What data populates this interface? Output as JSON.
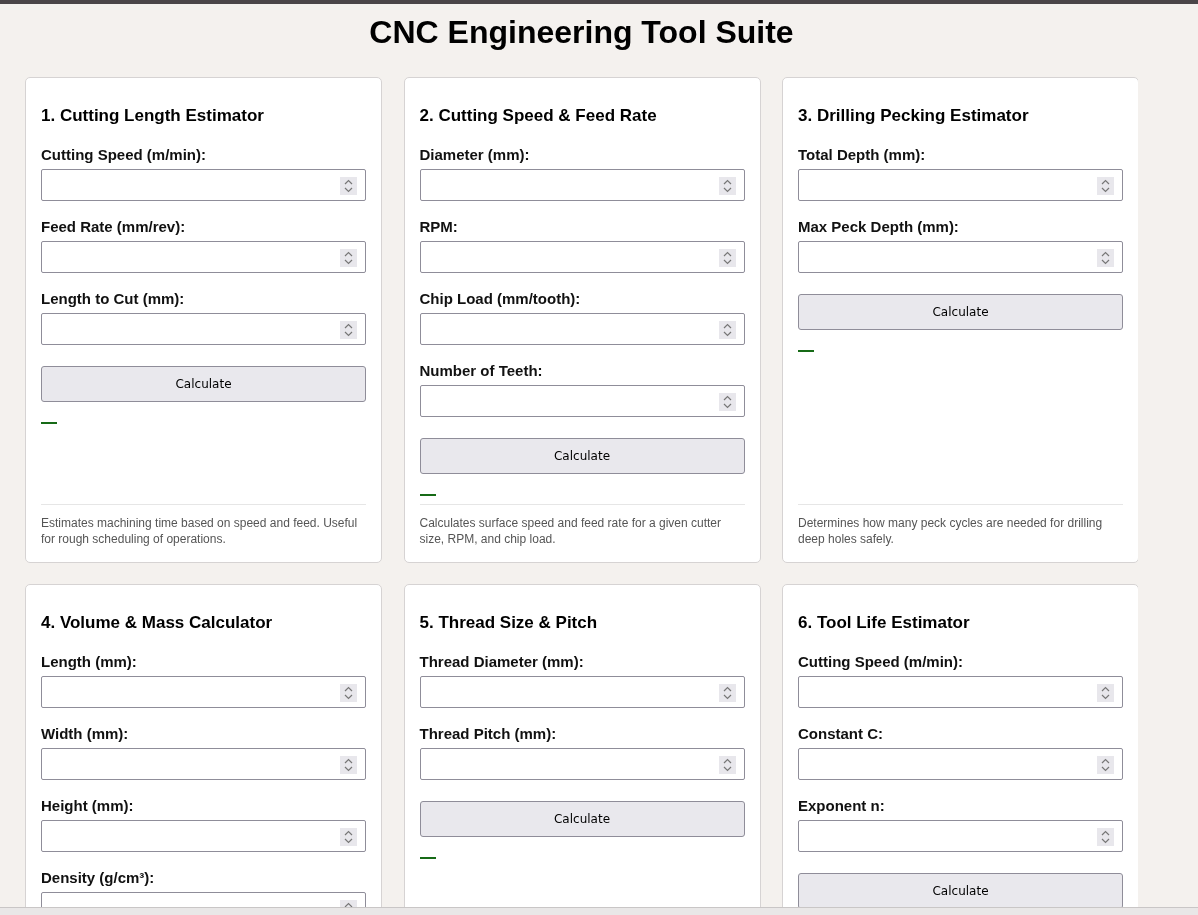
{
  "title": "CNC Engineering Tool Suite",
  "tools": [
    {
      "title": "1. Cutting Length Estimator",
      "fields": [
        {
          "label": "Cutting Speed (m/min):"
        },
        {
          "label": "Feed Rate (mm/rev):"
        },
        {
          "label": "Length to Cut (mm):"
        }
      ],
      "button": "Calculate",
      "description": "Estimates machining time based on speed and feed. Useful for rough scheduling of operations."
    },
    {
      "title": "2. Cutting Speed & Feed Rate",
      "fields": [
        {
          "label": "Diameter (mm):"
        },
        {
          "label": "RPM:"
        },
        {
          "label": "Chip Load (mm/tooth):"
        },
        {
          "label": "Number of Teeth:"
        }
      ],
      "button": "Calculate",
      "description": "Calculates surface speed and feed rate for a given cutter size, RPM, and chip load."
    },
    {
      "title": "3. Drilling Pecking Estimator",
      "fields": [
        {
          "label": "Total Depth (mm):"
        },
        {
          "label": "Max Peck Depth (mm):"
        }
      ],
      "button": "Calculate",
      "description": "Determines how many peck cycles are needed for drilling deep holes safely."
    },
    {
      "title": "4. Volume & Mass Calculator",
      "fields": [
        {
          "label": "Length (mm):"
        },
        {
          "label": "Width (mm):"
        },
        {
          "label": "Height (mm):"
        },
        {
          "label": "Density (g/cm³):"
        }
      ]
    },
    {
      "title": "5. Thread Size & Pitch",
      "fields": [
        {
          "label": "Thread Diameter (mm):"
        },
        {
          "label": "Thread Pitch (mm):"
        }
      ],
      "button": "Calculate"
    },
    {
      "title": "6. Tool Life Estimator",
      "fields": [
        {
          "label": "Cutting Speed (m/min):"
        },
        {
          "label": "Constant C:"
        },
        {
          "label": "Exponent n:"
        }
      ],
      "button": "Calculate"
    }
  ]
}
